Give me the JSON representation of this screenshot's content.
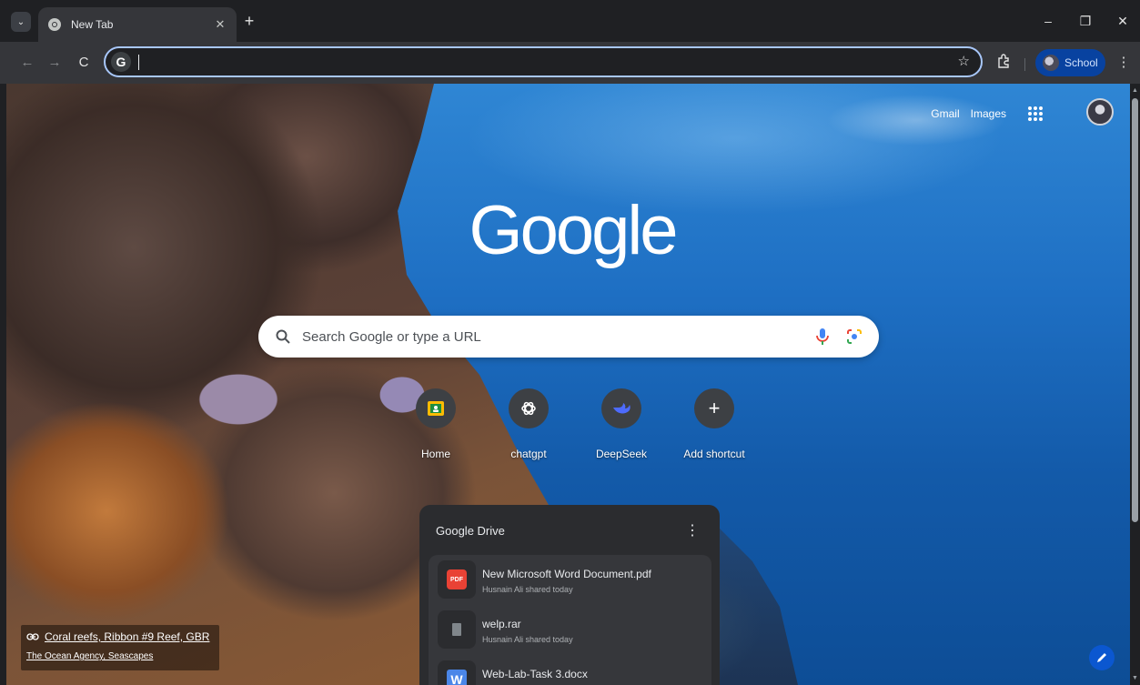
{
  "browser": {
    "tab": {
      "title": "New Tab",
      "close_glyph": "✕"
    },
    "new_tab_glyph": "+",
    "tab_search_glyph": "⌄",
    "window_controls": {
      "minimize": "–",
      "restore": "❐",
      "close": "✕"
    },
    "nav": {
      "back": "←",
      "forward": "→",
      "reload": "C"
    },
    "omnibox": {
      "badge": "G",
      "value": ""
    },
    "profile": {
      "label": "School"
    },
    "menu_glyph": "⋮",
    "icons": [
      "chevron-down-icon",
      "chrome-icon",
      "close-icon",
      "plus-icon",
      "back-icon",
      "forward-icon",
      "reload-icon",
      "star-icon",
      "extensions-icon",
      "menu-icon"
    ]
  },
  "ntp": {
    "top_links": {
      "gmail": "Gmail",
      "images": "Images"
    },
    "logo": "Google",
    "search": {
      "placeholder": "Search Google or type a URL"
    },
    "shortcuts": [
      {
        "label": "Home",
        "icon": "google-classroom-icon"
      },
      {
        "label": "chatgpt",
        "icon": "openai-icon"
      },
      {
        "label": "DeepSeek",
        "icon": "deepseek-icon"
      },
      {
        "label": "Add shortcut",
        "icon": "plus-icon",
        "glyph": "+"
      }
    ],
    "drive": {
      "title": "Google Drive",
      "more_glyph": "⋮",
      "files": [
        {
          "name": "New Microsoft Word Document.pdf",
          "meta": "Husnain Ali shared today",
          "type": "PDF"
        },
        {
          "name": "welp.rar",
          "meta": "Husnain Ali shared today",
          "type": "archive"
        },
        {
          "name": "Web-Lab-Task 3.docx",
          "meta": "",
          "type": "W"
        }
      ]
    },
    "attribution": {
      "title": "Coral reefs, Ribbon #9 Reef, GBR",
      "collection": "The Ocean Agency, Seascapes"
    },
    "colors": {
      "accent": "#0b57d0",
      "omnibox_focus": "#a8c7fa",
      "pdf_red": "#e94235",
      "word_blue": "#4a86e8"
    }
  }
}
